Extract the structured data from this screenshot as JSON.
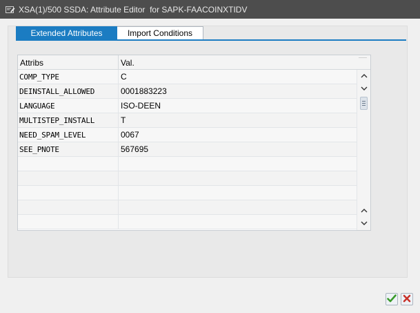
{
  "window": {
    "title": "XSA(1)/500 SSDA: Attribute Editor  for SAPK-FAACOINXTIDV",
    "title_icon": "window-edit-icon"
  },
  "tabs": [
    {
      "label": "Extended Attributes",
      "active": true
    },
    {
      "label": "Import Conditions",
      "active": false
    }
  ],
  "grid": {
    "columns": [
      "Attribs",
      "Val."
    ],
    "rows": [
      {
        "attrib": "COMP_TYPE",
        "value": "C"
      },
      {
        "attrib": "DEINSTALL_ALLOWED",
        "value": "0001883223"
      },
      {
        "attrib": "LANGUAGE",
        "value": "ISO-DEEN"
      },
      {
        "attrib": "MULTISTEP_INSTALL",
        "value": "T"
      },
      {
        "attrib": "NEED_SPAM_LEVEL",
        "value": "0067"
      },
      {
        "attrib": "SEE_PNOTE",
        "value": "567695"
      },
      {
        "attrib": "",
        "value": ""
      },
      {
        "attrib": "",
        "value": ""
      },
      {
        "attrib": "",
        "value": ""
      },
      {
        "attrib": "",
        "value": ""
      },
      {
        "attrib": "",
        "value": ""
      }
    ]
  },
  "footer": {
    "confirm_icon": "checkmark-icon",
    "cancel_icon": "cancel-x-icon"
  },
  "colors": {
    "titlebar": "#4d4d4d",
    "tab_active": "#1b7cc2",
    "confirm": "#3a9a2a",
    "cancel": "#c8322a"
  }
}
